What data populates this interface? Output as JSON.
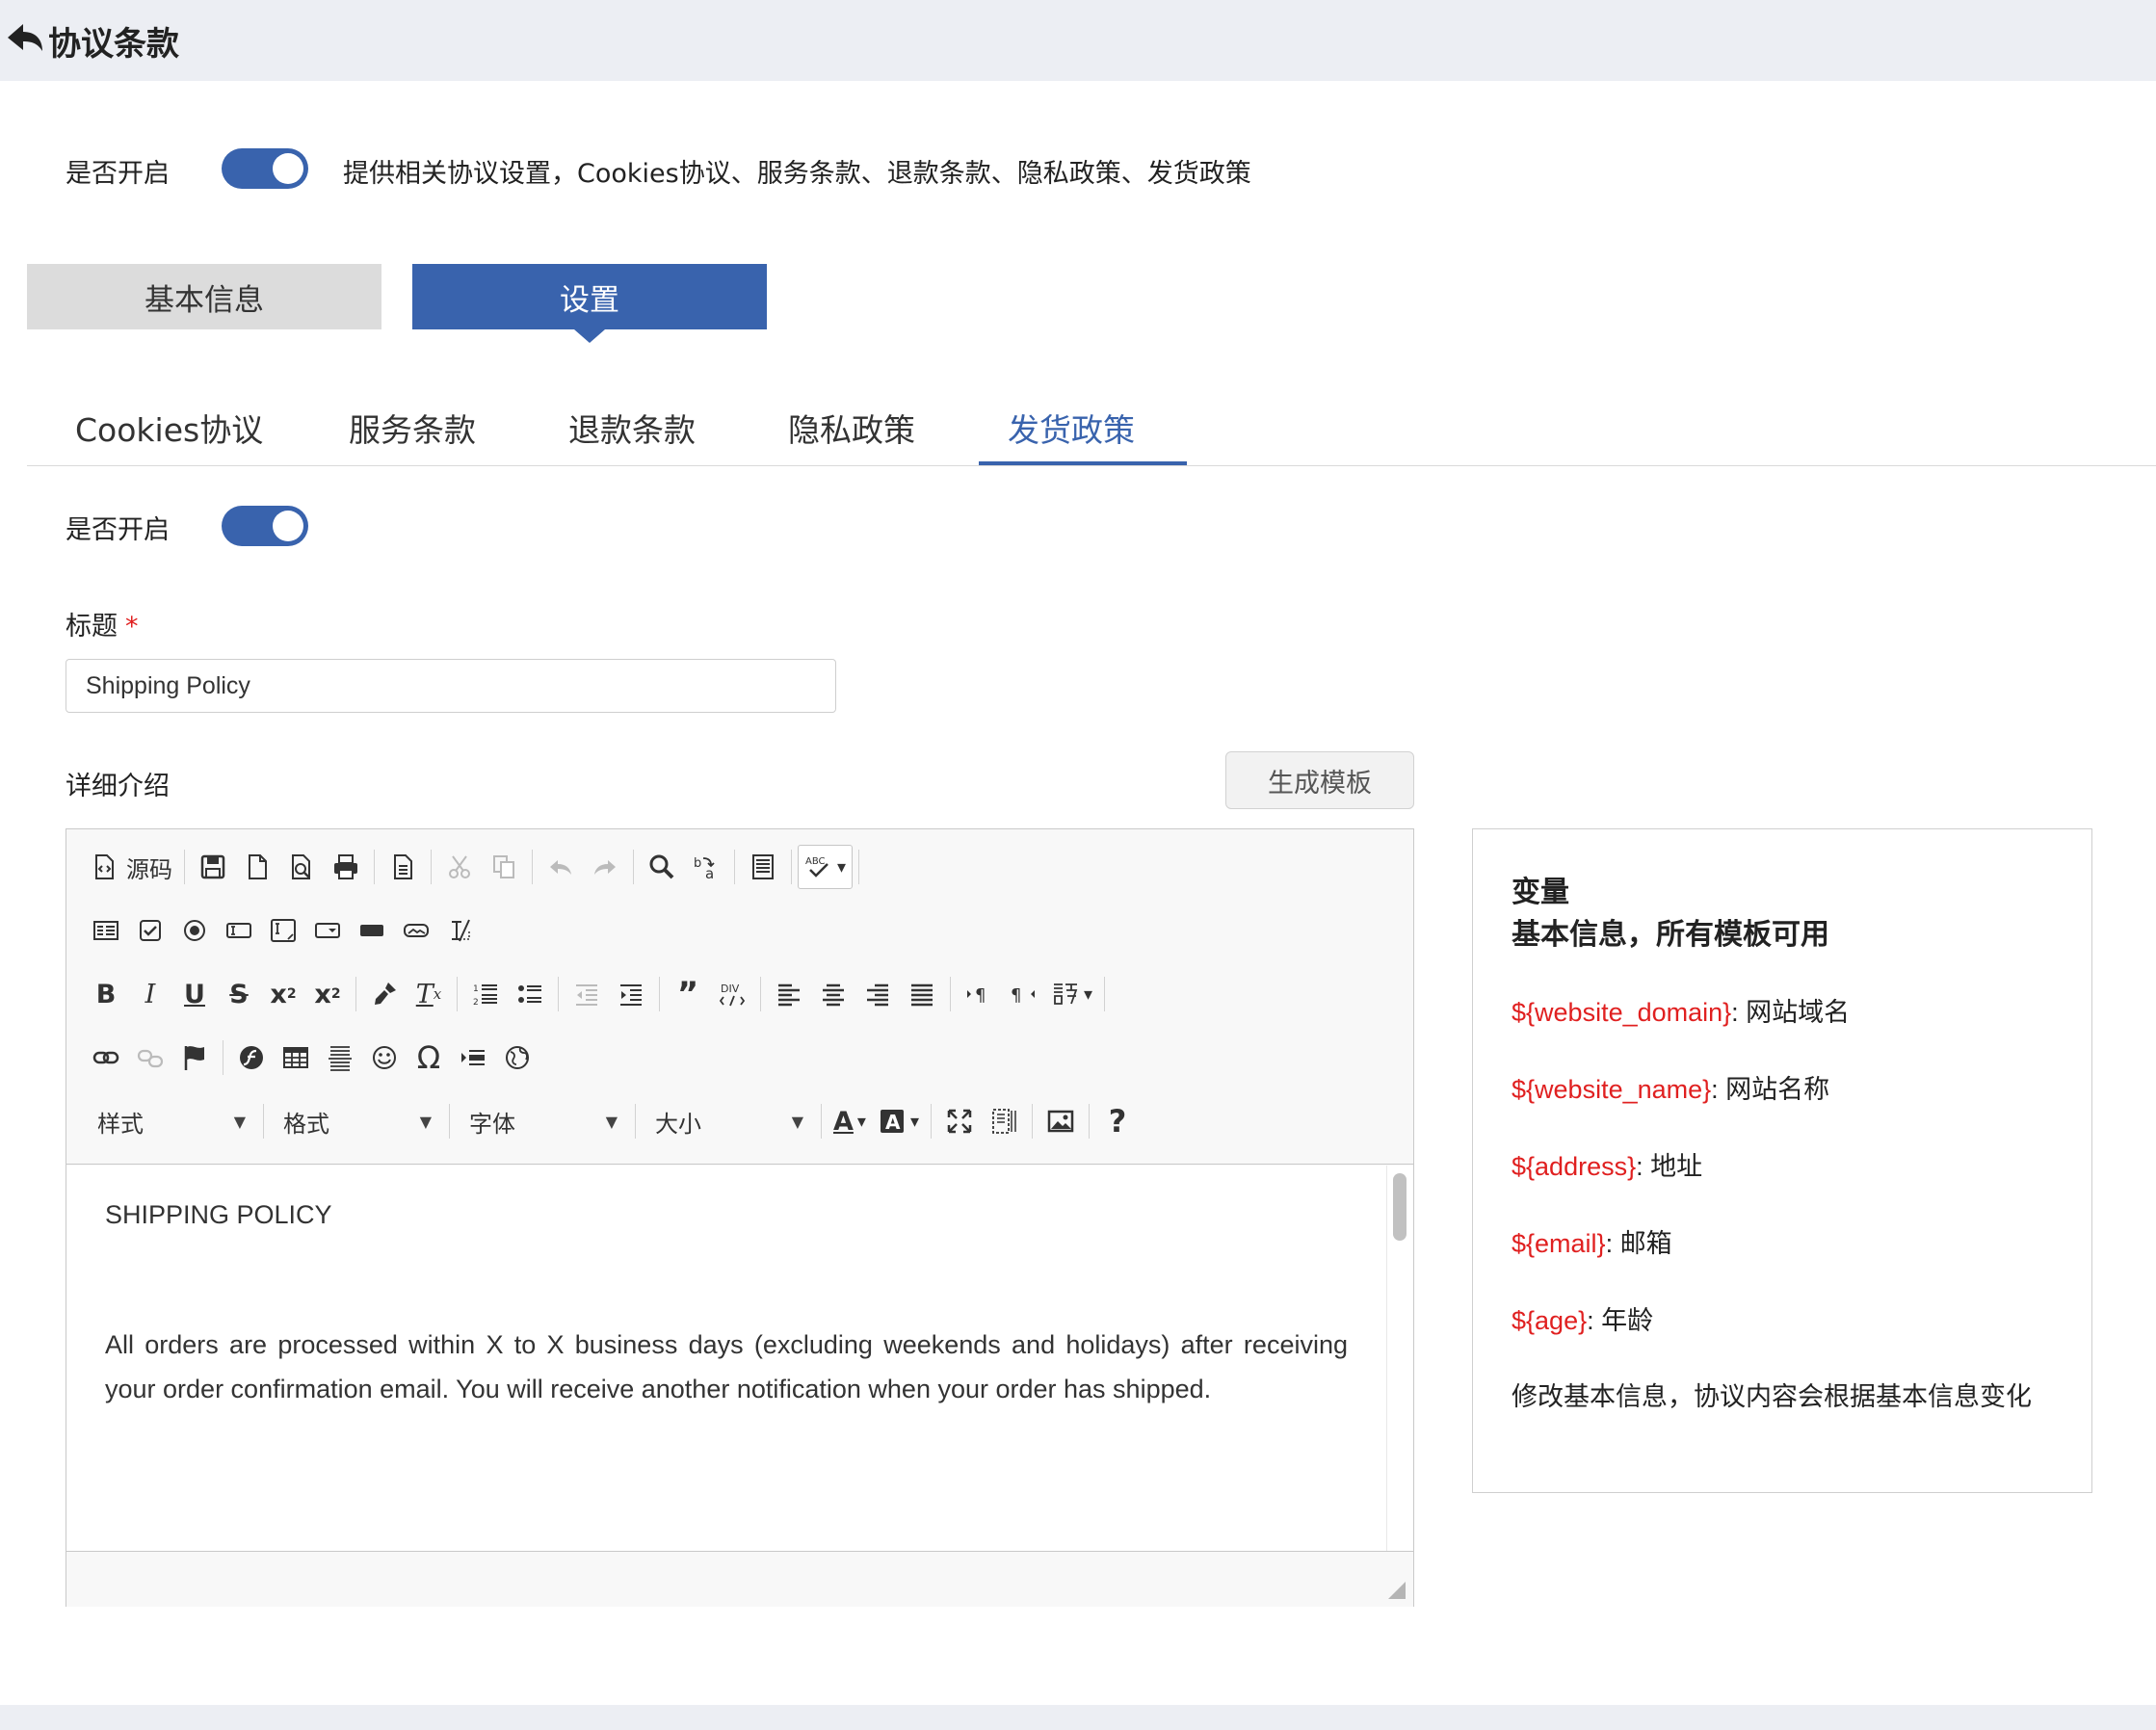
{
  "header": {
    "title": "协议条款"
  },
  "global_switch": {
    "label": "是否开启",
    "on": true,
    "description": "提供相关协议设置，Cookies协议、服务条款、退款条款、隐私政策、发货政策"
  },
  "segments": [
    {
      "label": "基本信息",
      "active": false
    },
    {
      "label": "设置",
      "active": true
    }
  ],
  "subtabs": [
    "Cookies协议",
    "服务条款",
    "退款条款",
    "隐私政策",
    "发货政策"
  ],
  "active_subtab": "发货政策",
  "policy_switch": {
    "label": "是否开启",
    "on": true
  },
  "title_field": {
    "label": "标题",
    "required_mark": "*",
    "value": "Shipping Policy"
  },
  "detail": {
    "label": "详细介绍",
    "generate_button": "生成模板"
  },
  "editor": {
    "source_label": "源码",
    "combos": {
      "style": "样式",
      "format": "格式",
      "font": "字体",
      "size": "大小"
    },
    "content_heading": "SHIPPING POLICY",
    "content_paragraph": "All orders are processed within X to X business days (excluding weekends and holidays) after receiving your order confirmation email. You will receive another notification when your order has shipped."
  },
  "variables": {
    "heading1": "变量",
    "heading2": "基本信息，所有模板可用",
    "items": [
      {
        "key": "${website_domain}",
        "desc": ": 网站域名"
      },
      {
        "key": "${website_name}",
        "desc": ": 网站名称"
      },
      {
        "key": "${address}",
        "desc": ": 地址"
      },
      {
        "key": "${email}",
        "desc": ": 邮箱"
      },
      {
        "key": "${age}",
        "desc": ": 年龄"
      }
    ],
    "note": "修改基本信息，协议内容会根据基本信息变化"
  },
  "colors": {
    "accent": "#3963ad",
    "variable_key": "#e02020",
    "header_bg": "#eceef3"
  }
}
